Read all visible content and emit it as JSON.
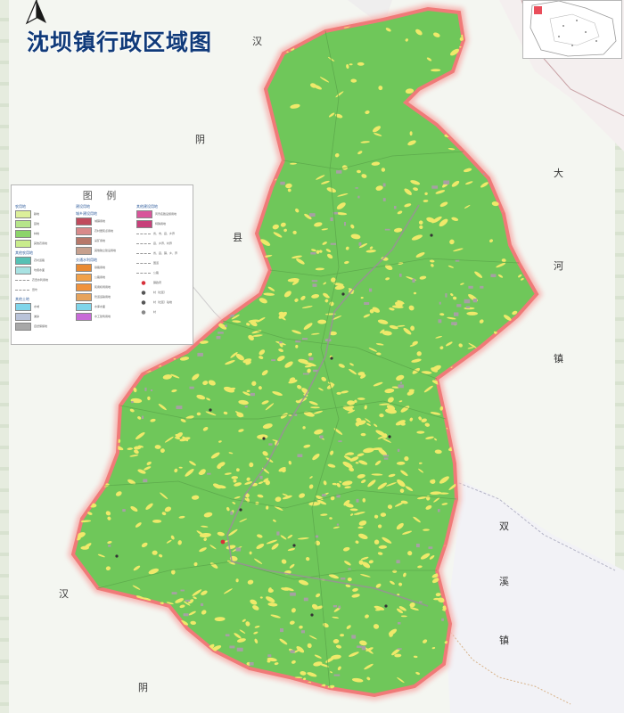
{
  "title": "沈坝镇行政区域图",
  "colors": {
    "land_green": "#6fc75a",
    "farmland_yellow": "#efe96a",
    "settlement_gray": "#a7a0a4",
    "boundary_red": "#f07a78",
    "title_blue": "#103a7a"
  },
  "compass": {
    "icon": "north-arrow-icon"
  },
  "neighbors": [
    {
      "id": "n1",
      "text": "汉"
    },
    {
      "id": "n2",
      "text": "阴"
    },
    {
      "id": "n3",
      "text": "县"
    },
    {
      "id": "n4",
      "text": "大"
    },
    {
      "id": "n5",
      "text": "河"
    },
    {
      "id": "n6",
      "text": "镇"
    },
    {
      "id": "n7",
      "text": "双"
    },
    {
      "id": "n8",
      "text": "溪"
    },
    {
      "id": "n9",
      "text": "镇"
    },
    {
      "id": "n10",
      "text": "汉"
    },
    {
      "id": "n11",
      "text": "阴"
    }
  ],
  "legend": {
    "title": "图 例",
    "col1": [
      {
        "type": "cat",
        "text": "农用地"
      },
      {
        "type": "item",
        "color": "#dcef9a",
        "text": "耕地"
      },
      {
        "type": "item",
        "color": "#b6e58a",
        "text": "园地"
      },
      {
        "type": "item",
        "color": "#8cd46a",
        "text": "林地"
      },
      {
        "type": "item",
        "color": "#c9ec8c",
        "text": "其他农用地"
      },
      {
        "type": "cat",
        "text": "其他农用地"
      },
      {
        "type": "item",
        "color": "#56c1b4",
        "text": "农村道路"
      },
      {
        "type": "item",
        "color": "#a8e2e2",
        "text": "坑塘水面"
      },
      {
        "type": "line",
        "text": "农田水利用地"
      },
      {
        "type": "line",
        "text": "田坎"
      },
      {
        "type": "cat",
        "text": "其他土地"
      },
      {
        "type": "item",
        "color": "#7fd5ea",
        "text": "水域"
      },
      {
        "type": "item",
        "color": "#b9c3d9",
        "text": "滩涂"
      },
      {
        "type": "item",
        "color": "#a8a8a8",
        "text": "自然保留地"
      }
    ],
    "col2": [
      {
        "type": "cat",
        "text": "建设用地"
      },
      {
        "type": "cat",
        "text": "城乡建设用地"
      },
      {
        "type": "item",
        "color": "#c04a5c",
        "text": "城镇用地"
      },
      {
        "type": "item",
        "color": "#d88a8a",
        "text": "农村居民点用地"
      },
      {
        "type": "item",
        "color": "#b7786a",
        "text": "采矿用地"
      },
      {
        "type": "item",
        "color": "#c6a08e",
        "text": "其他独立建设用地"
      },
      {
        "type": "cat",
        "text": "交通水利用地"
      },
      {
        "type": "item",
        "color": "#e98a32",
        "text": "铁路用地"
      },
      {
        "type": "item",
        "color": "#f1a14a",
        "text": "公路用地"
      },
      {
        "type": "item",
        "color": "#f0923c",
        "text": "民用机场用地"
      },
      {
        "type": "item",
        "color": "#e6a35c",
        "text": "管道运输用地"
      },
      {
        "type": "item",
        "color": "#7fd5ea",
        "text": "水库水面"
      },
      {
        "type": "item",
        "color": "#c86ad8",
        "text": "水工建筑用地"
      }
    ],
    "col3": [
      {
        "type": "cat",
        "text": "其他建设用地"
      },
      {
        "type": "item",
        "color": "#d8559a",
        "text": "风景名胜设施用地"
      },
      {
        "type": "item",
        "color": "#c7407a",
        "text": "特殊用地"
      },
      {
        "type": "line",
        "text": "省、市、县、乡界"
      },
      {
        "type": "line",
        "text": "县、乡界、村界"
      },
      {
        "type": "line",
        "text": "省、县、镇、乡、界"
      },
      {
        "type": "line",
        "text": "国道"
      },
      {
        "type": "line",
        "text": "公路"
      },
      {
        "type": "mark",
        "color": "#d7303a",
        "text": "镇政府"
      },
      {
        "type": "mark",
        "color": "#555555",
        "text": "村（社区）"
      },
      {
        "type": "mark",
        "color": "#555555",
        "text": "村（社区）驻地"
      },
      {
        "type": "mark",
        "color": "#888888",
        "text": "村"
      }
    ]
  }
}
